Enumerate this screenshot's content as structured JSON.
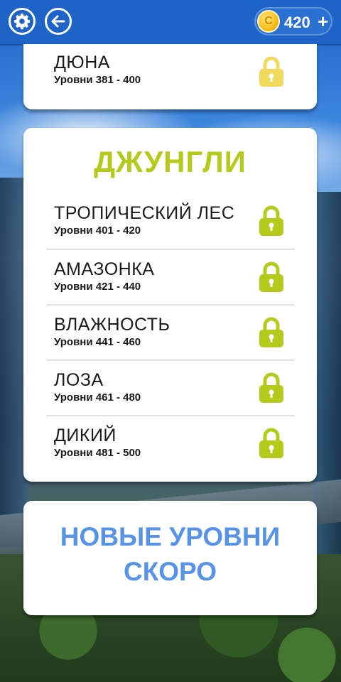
{
  "header": {
    "settings_icon": "gear-icon",
    "back_icon": "back-arrow-icon",
    "coins": "420",
    "coin_symbol": "C",
    "plus": "+"
  },
  "colors": {
    "topbar": "#1e63c8",
    "jungle_green": "#b5cb1b",
    "desert_yellow": "#f1d95c",
    "soon_blue": "#5793e8"
  },
  "top_card": {
    "title": "ДЮНА",
    "levels": "Уровни 381 - 400",
    "locked": true
  },
  "jungle": {
    "title": "ДЖУНГЛИ",
    "items": [
      {
        "title": "ТРОПИЧЕСКИЙ ЛЕС",
        "levels": "Уровни 401 - 420",
        "locked": true
      },
      {
        "title": "АМАЗОНКА",
        "levels": "Уровни 421 - 440",
        "locked": true
      },
      {
        "title": "ВЛАЖНОСТЬ",
        "levels": "Уровни 441 - 460",
        "locked": true
      },
      {
        "title": "ЛОЗА",
        "levels": "Уровни 461 - 480",
        "locked": true
      },
      {
        "title": "ДИКИЙ",
        "levels": "Уровни 481 - 500",
        "locked": true
      }
    ]
  },
  "coming_soon": {
    "line1": "НОВЫЕ УРОВНИ",
    "line2": "СКОРО"
  }
}
